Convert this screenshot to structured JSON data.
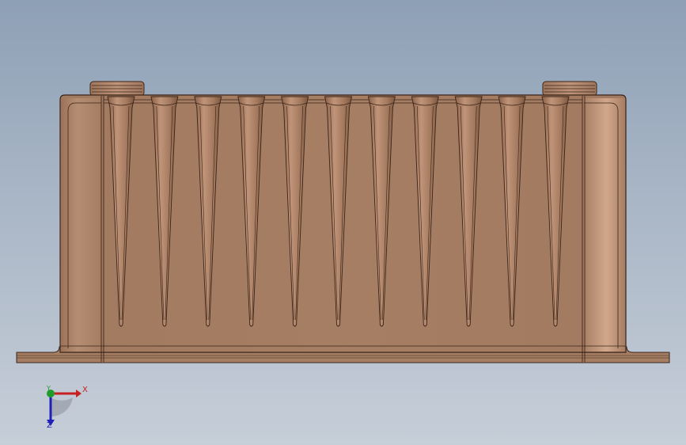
{
  "viewport": {
    "background_top": "#8ea0b6",
    "background_bottom": "#c6ced8"
  },
  "model": {
    "body_color": "#a67e63",
    "edge_color": "#3a2418",
    "highlight_color": "#cfa58a",
    "groove_count": 11
  },
  "triad": {
    "x_label": "X",
    "y_label": "Y",
    "z_label": "Z",
    "x_color": "#c62020",
    "y_color": "#1f9d2a",
    "z_color": "#2020b8"
  }
}
